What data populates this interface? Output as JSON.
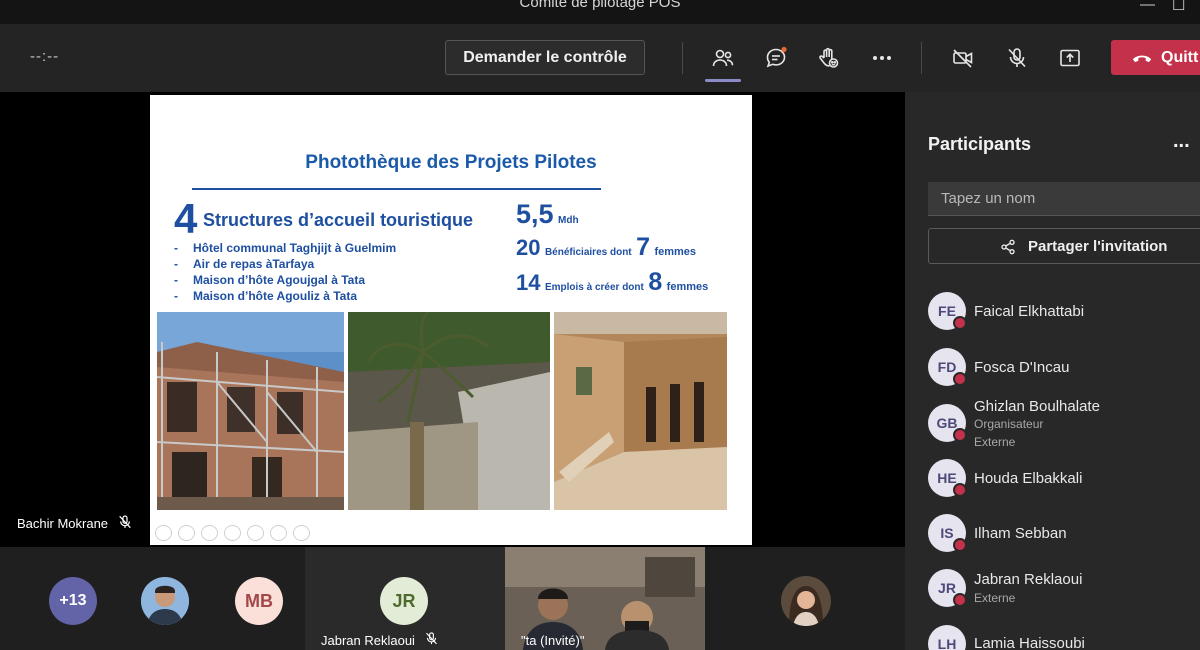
{
  "window": {
    "title": "Comité de pilotage POS"
  },
  "toolbar": {
    "timer": "--:--",
    "request_control_label": "Demander le contrôle",
    "leave_label": "Quitt"
  },
  "slide": {
    "title": "Photothèque des Projets Pilotes",
    "structures_count": "4",
    "structures_label": "Structures d’accueil touristique",
    "items": [
      "Hôtel communal Taghjijt à Guelmim",
      "Air de repas àTarfaya",
      "Maison d’hôte Agoujgal à Tata",
      "Maison d’hôte Agouliz à Tata"
    ],
    "budget_value": "5,5",
    "budget_unit": "Mdh",
    "beneficiaries_value": "20",
    "beneficiaries_text": "Bénéficiaires dont",
    "beneficiaries_women": "7",
    "beneficiaries_women_label": "femmes",
    "jobs_value": "14",
    "jobs_text": "Emplois à créer dont",
    "jobs_women": "8",
    "jobs_women_label": "femmes"
  },
  "stage": {
    "presenter_name": "Bachir Mokrane"
  },
  "strip": {
    "overflow_count": "+13",
    "mb_initials": "MB",
    "jr_initials": "JR",
    "jr_name": "Jabran Reklaoui",
    "video_name": "ta (Invité)"
  },
  "panel": {
    "title": "Participants",
    "more": "...",
    "search_placeholder": "Tapez un nom",
    "share_label": "Partager l'invitation",
    "participants": [
      {
        "initials": "FE",
        "name": "Faical Elkhattabi"
      },
      {
        "initials": "FD",
        "name": "Fosca D'Incau"
      },
      {
        "initials": "GB",
        "name": "Ghizlan Boulhalate",
        "role": "Organisateur",
        "sub": "Externe"
      },
      {
        "initials": "HE",
        "name": "Houda Elbakkali"
      },
      {
        "initials": "IS",
        "name": "Ilham Sebban"
      },
      {
        "initials": "JR",
        "name": "Jabran Reklaoui",
        "sub": "Externe"
      },
      {
        "initials": "LH",
        "name": "Lamia Haissoubi"
      }
    ]
  },
  "colors": {
    "accent": "#8b8cc7",
    "leave": "#c4314b",
    "slide_blue": "#1e4fa0"
  }
}
